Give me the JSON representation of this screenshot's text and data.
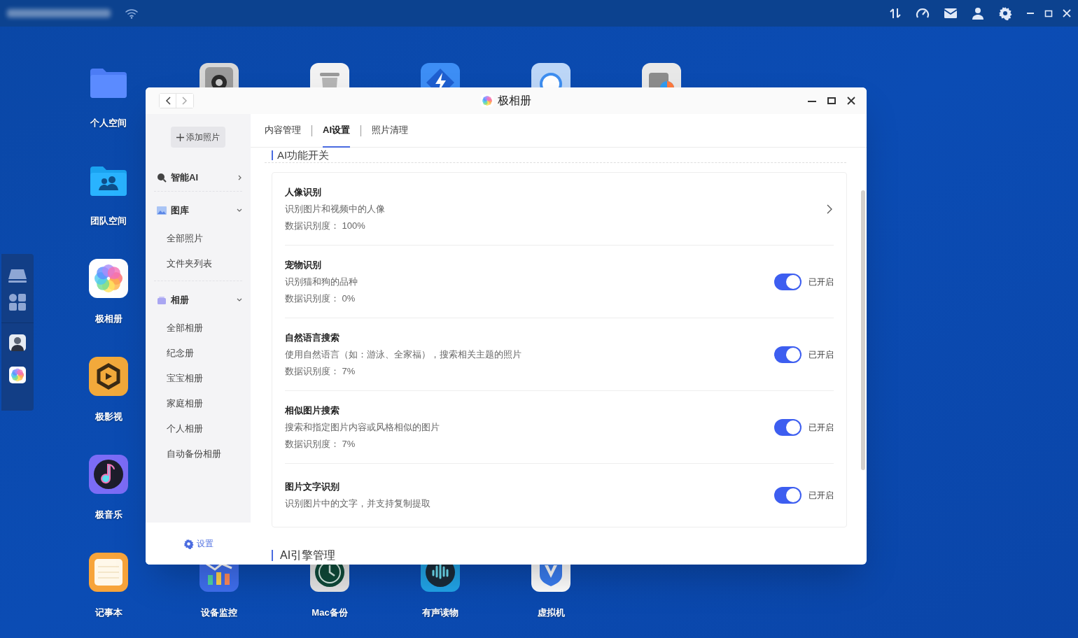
{
  "desktop_apps": [
    {
      "label": "个人空间"
    },
    {
      "label": "团队空间"
    },
    {
      "label": "极相册"
    },
    {
      "label": "极影视"
    },
    {
      "label": "极音乐"
    },
    {
      "label": "记事本"
    },
    {
      "label": "设备监控"
    },
    {
      "label": "Mac备份"
    },
    {
      "label": "有声读物"
    },
    {
      "label": "虚拟机"
    }
  ],
  "window": {
    "title": "极相册",
    "sidebar": {
      "add_button": "添加照片",
      "sections": [
        {
          "label": "智能AI",
          "expanded": false
        },
        {
          "label": "图库",
          "expanded": true,
          "items": [
            "全部照片",
            "文件夹列表"
          ]
        },
        {
          "label": "相册",
          "expanded": true,
          "items": [
            "全部相册",
            "纪念册",
            "宝宝相册",
            "家庭相册",
            "个人相册",
            "自动备份相册"
          ]
        }
      ],
      "settings": "设置"
    },
    "tabs": [
      {
        "label": "内容管理",
        "selected": false
      },
      {
        "label": "AI设置",
        "selected": true
      },
      {
        "label": "照片清理",
        "selected": false
      }
    ],
    "section_title": "AI功能开关",
    "features": [
      {
        "kind": "link",
        "title": "人像识别",
        "description": "识别图片和视频中的人像",
        "accuracy": "数据识别度： 100%"
      },
      {
        "kind": "toggle",
        "title": "宠物识别",
        "description": "识别猫和狗的品种",
        "accuracy": "数据识别度： 0%",
        "on": true,
        "status": "已开启"
      },
      {
        "kind": "toggle",
        "title": "自然语言搜索",
        "description": "使用自然语言（如：游泳、全家福），搜索相关主题的照片",
        "accuracy": "数据识别度： 7%",
        "on": true,
        "status": "已开启"
      },
      {
        "kind": "toggle",
        "title": "相似图片搜索",
        "description": "搜索和指定图片内容或风格相似的图片",
        "accuracy": "数据识别度： 7%",
        "on": true,
        "status": "已开启"
      },
      {
        "kind": "toggle",
        "title": "图片文字识别",
        "description": "识别图片中的文字，并支持复制提取",
        "on": true,
        "status": "已开启"
      }
    ],
    "next_section": "AI引擎管理"
  }
}
